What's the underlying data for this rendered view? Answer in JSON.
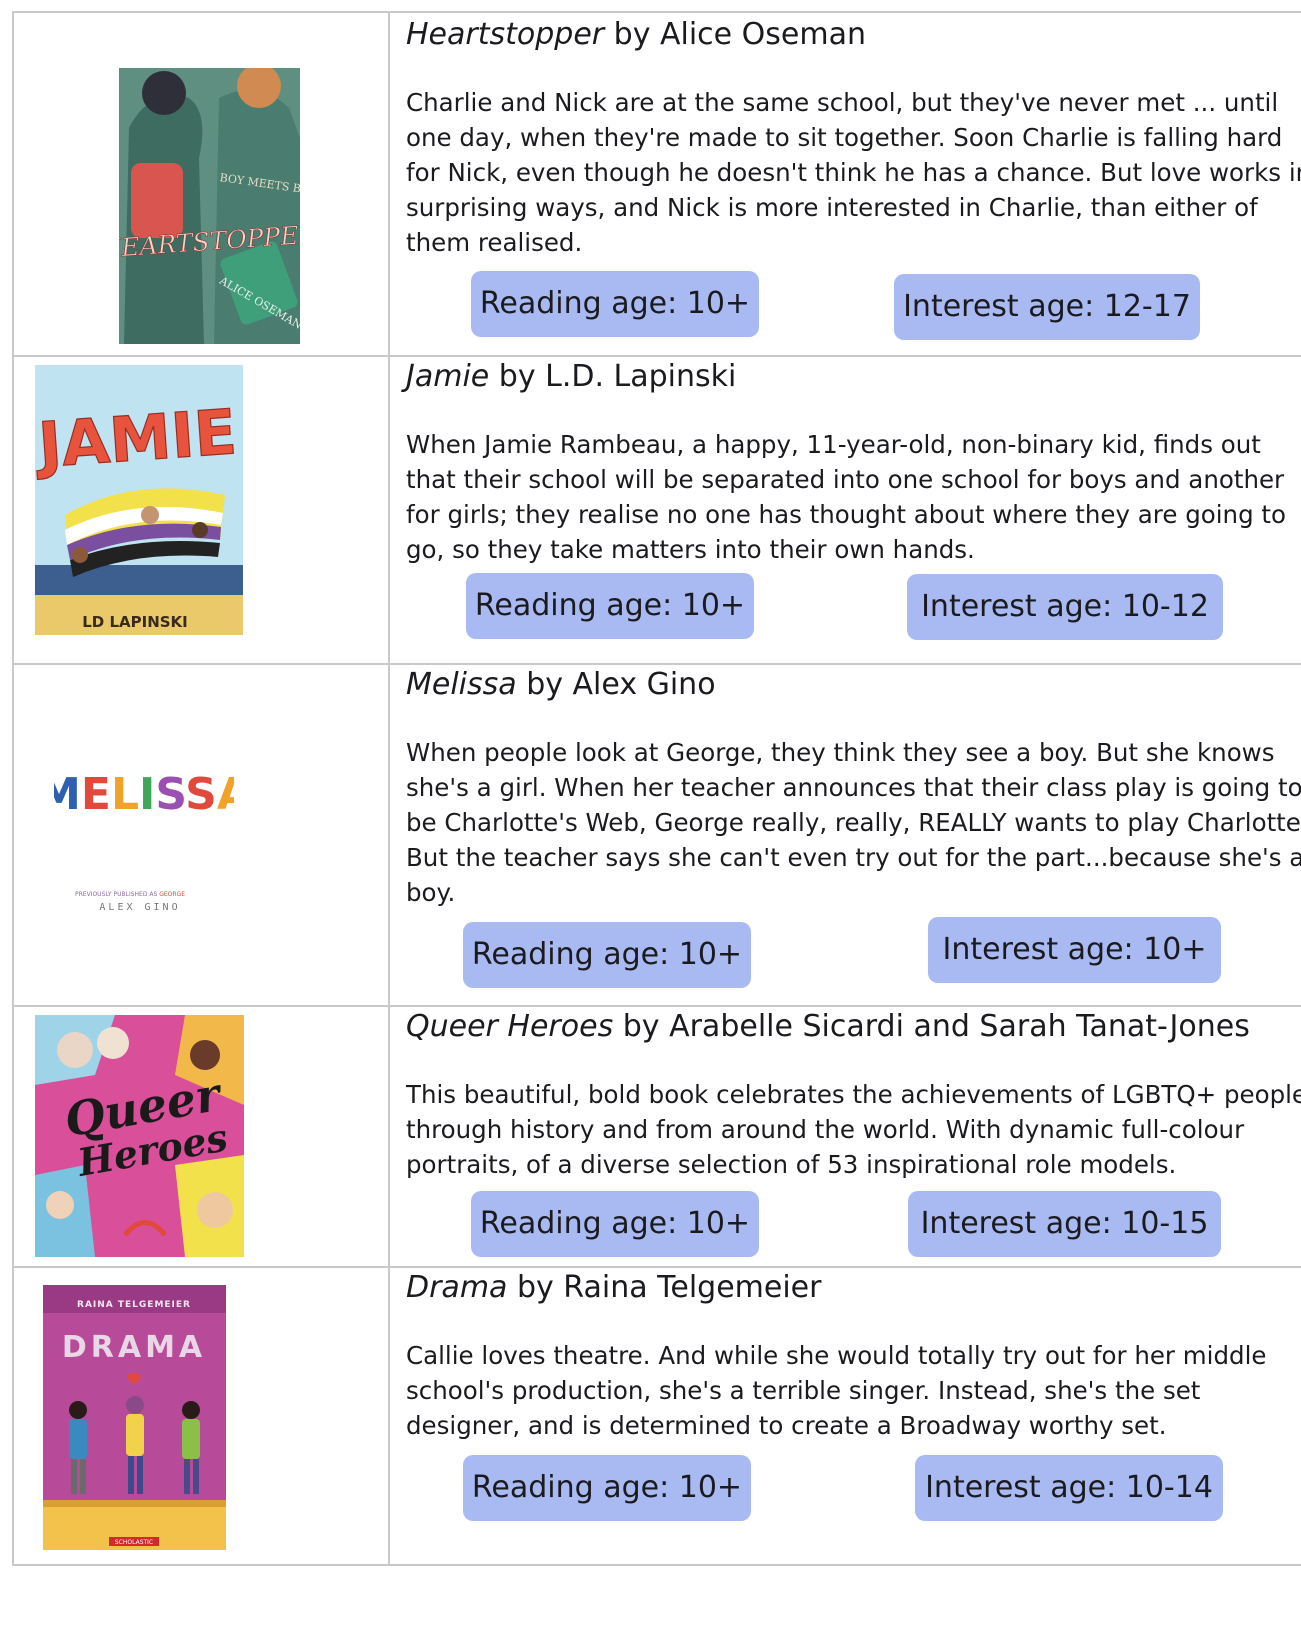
{
  "books": [
    {
      "title": "Heartstopper",
      "author_line": " by Alice Oseman",
      "description": "Charlie and Nick are at the same school, but they've never met ... until one day, when they're made to sit together. Soon Charlie is falling hard for Nick, even though he doesn't think he has a chance. But love works in surprising ways, and Nick is more interested in Charlie, than either of them realised.",
      "reading_age": "Reading age: 10+",
      "interest_age": "Interest age: 12-17",
      "cover_text": [
        "BOY MEETS BOY.",
        "HEARTSTOPPER",
        "ALICE OSEMAN"
      ]
    },
    {
      "title": "Jamie",
      "author_line": " by L.D. Lapinski",
      "description": "When Jamie Rambeau, a happy, 11-year-old, non-binary kid, finds out that their school will be separated into one school for boys and another for girls; they realise no one has thought about where they are going to go, so they take matters into their own hands.",
      "reading_age": "Reading age: 10+",
      "interest_age": "Interest age: 10-12",
      "cover_text": [
        "JAMIE",
        "LD LAPINSKI"
      ]
    },
    {
      "title": "Melissa",
      "author_line": " by Alex Gino",
      "description": "When people look at George, they think they see a boy. But she knows she's a girl. When her teacher announces that their class play is going to be Charlotte's Web, George really, really, REALLY wants to play Charlotte. But the teacher says she can't even try out for the part...because she's a boy.",
      "reading_age": "Reading age: 10+",
      "interest_age": "Interest age: 10+",
      "cover_text": [
        "MELISSA",
        "PREVIOUSLY PUBLISHED AS",
        "GEORGE",
        "ALEX GINO"
      ]
    },
    {
      "title": "Queer Heroes",
      "author_line": " by Arabelle Sicardi and Sarah Tanat-Jones",
      "description": "This beautiful, bold book celebrates the achievements of LGBTQ+ people through history and from around the world. With dynamic full-colour portraits, of a diverse selection of 53 inspirational role models.",
      "reading_age": "Reading age: 10+",
      "interest_age": "Interest age: 10-15",
      "cover_text": [
        "Queer",
        "Heroes"
      ]
    },
    {
      "title": "Drama",
      "author_line": " by Raina Telgemeier",
      "description": "Callie loves theatre. And while she would totally try out for her middle school's production, she's a terrible singer. Instead, she's the set designer, and is determined to create a Broadway worthy set.",
      "reading_age": "Reading age: 10+",
      "interest_age": "Interest age: 10-14",
      "cover_text": [
        "RAINA TELGEMEIER",
        "DRAMA",
        "SCHOLASTIC"
      ]
    }
  ]
}
